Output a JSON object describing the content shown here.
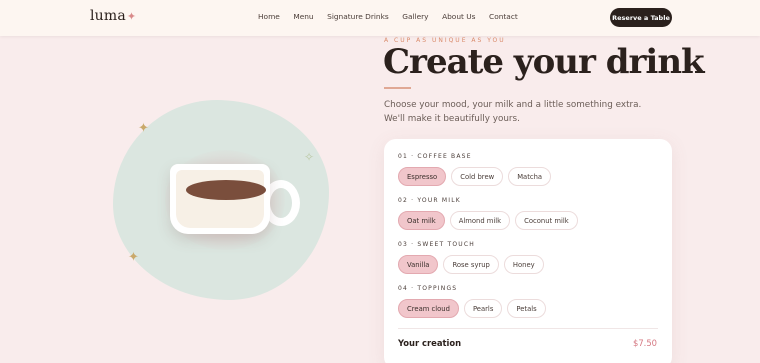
{
  "brand": {
    "name": "luma"
  },
  "nav": {
    "items": [
      "Home",
      "Menu",
      "Signature Drinks",
      "Gallery",
      "About Us",
      "Contact"
    ],
    "cta": "Reserve a Table"
  },
  "hero": {
    "eyebrow": "A CUP AS UNIQUE AS YOU",
    "title": "Create your drink",
    "subtitle": "Choose your mood, your milk and a little something extra. We'll make it beautifully yours."
  },
  "builder": {
    "sections": [
      {
        "label": "01 · COFFEE BASE",
        "options": [
          "Espresso",
          "Cold brew",
          "Matcha"
        ],
        "selected": "Espresso"
      },
      {
        "label": "02 · YOUR MILK",
        "options": [
          "Oat milk",
          "Almond milk",
          "Coconut milk"
        ],
        "selected": "Oat milk"
      },
      {
        "label": "03 · SWEET TOUCH",
        "options": [
          "Vanilla",
          "Rose syrup",
          "Honey"
        ],
        "selected": "Vanilla"
      },
      {
        "label": "04 · TOPPINGS",
        "options": [
          "Cream cloud",
          "Pearls",
          "Petals"
        ],
        "selected": "Cream cloud"
      }
    ],
    "total_label": "Your creation",
    "total_price": "$7.50"
  },
  "icons": {
    "logo_mark": "sparkle-icon",
    "decor": [
      "sparkle-icon",
      "sparkle-icon",
      "sparkle-icon"
    ]
  },
  "colors": {
    "background": "#f9ecec",
    "header": "#fdf6f1",
    "accent": "#d57882",
    "selected_chip": "#f1c6cb",
    "cta": "#2a201c",
    "eyebrow": "#d98a6a"
  }
}
